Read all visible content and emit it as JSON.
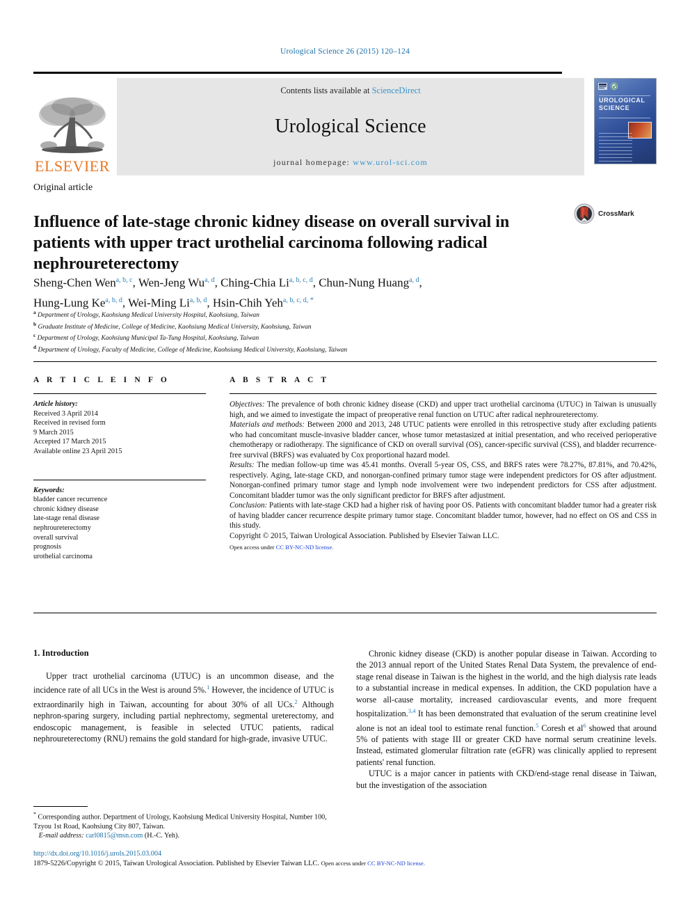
{
  "running_head": "Urological Science 26 (2015) 120–124",
  "masthead": {
    "contents_prefix": "Contents lists available at ",
    "sciencedirect": "ScienceDirect",
    "journal_name": "Urological Science",
    "homepage_prefix": "journal homepage: ",
    "homepage_url": "www.urol-sci.com",
    "publisher_logo_text": "ELSEVIER",
    "cover_title_line1": "UROLOGICAL",
    "cover_title_line2": "SCIENCE"
  },
  "article": {
    "type": "Original article",
    "title": "Influence of late-stage chronic kidney disease on overall survival in patients with upper tract urothelial carcinoma following radical nephroureterectomy",
    "crossmark_label": "CrossMark"
  },
  "authors": {
    "line1": "Sheng-Chen Wen a, b, c, Wen-Jeng Wu a, d, Ching-Chia Li a, b, c, d, Chun-Nung Huang a, d,",
    "line2": "Hung-Lung Ke a, b, d, Wei-Ming Li a, b, d, Hsin-Chih Yeh a, b, c, d, *",
    "list": [
      {
        "name": "Sheng-Chen Wen",
        "marks": "a, b, c"
      },
      {
        "name": "Wen-Jeng Wu",
        "marks": "a, d"
      },
      {
        "name": "Ching-Chia Li",
        "marks": "a, b, c, d"
      },
      {
        "name": "Chun-Nung Huang",
        "marks": "a, d"
      },
      {
        "name": "Hung-Lung Ke",
        "marks": "a, b, d"
      },
      {
        "name": "Wei-Ming Li",
        "marks": "a, b, d"
      },
      {
        "name": "Hsin-Chih Yeh",
        "marks": "a, b, c, d, *"
      }
    ]
  },
  "affiliations": [
    {
      "label": "a",
      "text": "Department of Urology, Kaohsiung Medical University Hospital, Kaohsiung, Taiwan"
    },
    {
      "label": "b",
      "text": "Graduate Institute of Medicine, College of Medicine, Kaohsiung Medical University, Kaohsiung, Taiwan"
    },
    {
      "label": "c",
      "text": "Department of Urology, Kaohsiung Municipal Ta-Tung Hospital, Kaohsiung, Taiwan"
    },
    {
      "label": "d",
      "text": "Department of Urology, Faculty of Medicine, College of Medicine, Kaohsiung Medical University, Kaohsiung, Taiwan"
    }
  ],
  "article_info": {
    "heading": "A R T I C L E  I N F O",
    "history_label": "Article history:",
    "history": [
      "Received 3 April 2014",
      "Received in revised form",
      "9 March 2015",
      "Accepted 17 March 2015",
      "Available online 23 April 2015"
    ],
    "keywords_label": "Keywords:",
    "keywords": [
      "bladder cancer recurrence",
      "chronic kidney disease",
      "late-stage renal disease",
      "nephroureterectomy",
      "overall survival",
      "prognosis",
      "urothelial carcinoma"
    ]
  },
  "abstract": {
    "heading": "A B S T R A C T",
    "objectives_label": "Objectives:",
    "objectives": " The prevalence of both chronic kidney disease (CKD) and upper tract urothelial carcinoma (UTUC) in Taiwan is unusually high, and we aimed to investigate the impact of preoperative renal function on UTUC after radical nephroureterectomy.",
    "methods_label": "Materials and methods:",
    "methods": " Between 2000 and 2013, 248 UTUC patients were enrolled in this retrospective study after excluding patients who had concomitant muscle-invasive bladder cancer, whose tumor metastasized at initial presentation, and who received perioperative chemotherapy or radiotherapy. The significance of CKD on overall survival (OS), cancer-specific survival (CSS), and bladder recurrence-free survival (BRFS) was evaluated by Cox proportional hazard model.",
    "results_label": "Results:",
    "results": " The median follow-up time was 45.41 months. Overall 5-year OS, CSS, and BRFS rates were 78.27%, 87.81%, and 70.42%, respectively. Aging, late-stage CKD, and nonorgan-confined primary tumor stage were independent predictors for OS after adjustment. Nonorgan-confined primary tumor stage and lymph node involvement were two independent predictors for CSS after adjustment. Concomitant bladder tumor was the only significant predictor for BRFS after adjustment.",
    "conclusion_label": "Conclusion:",
    "conclusion": " Patients with late-stage CKD had a higher risk of having poor OS. Patients with concomitant bladder tumor had a greater risk of having bladder cancer recurrence despite primary tumor stage. Concomitant bladder tumor, however, had no effect on OS and CSS in this study.",
    "copyright": "Copyright © 2015, Taiwan Urological Association. Published by Elsevier Taiwan LLC.",
    "open_access_prefix": "Open access under ",
    "open_access_link": "CC BY-NC-ND license."
  },
  "body": {
    "section_number_title": "1.  Introduction",
    "left_paragraph_1": "Upper tract urothelial carcinoma (UTUC) is an uncommon disease, and the incidence rate of all UCs in the West is around 5%.",
    "left_ref_1": "1",
    "left_paragraph_1b": " However, the incidence of UTUC is extraordinarily high in Taiwan, accounting for about 30% of all UCs.",
    "left_ref_2": "2",
    "left_paragraph_1c": " Although nephron-sparing surgery, including partial nephrectomy, segmental ureterectomy, and endoscopic management, is feasible in selected UTUC patients, radical nephroureterectomy (RNU) remains the gold standard for high-grade, invasive UTUC.",
    "right_paragraph_1a": "Chronic kidney disease (CKD) is another popular disease in Taiwan. According to the 2013 annual report of the United States Renal Data System, the prevalence of end-stage renal disease in Taiwan is the highest in the world, and the high dialysis rate leads to a substantial increase in medical expenses. In addition, the CKD population have a worse all-cause mortality, increased cardiovascular events, and more frequent hospitalization.",
    "right_ref_34": "3,4",
    "right_paragraph_1b": " It has been demonstrated that evaluation of the serum creatinine level alone is not an ideal tool to estimate renal function.",
    "right_ref_5": "5",
    "right_paragraph_1c": " Coresh et al",
    "right_ref_6": "6",
    "right_paragraph_1d": " showed that around 5% of patients with stage III or greater CKD have normal serum creatinine levels. Instead, estimated glomerular filtration rate (eGFR) was clinically applied to represent patients' renal function.",
    "right_paragraph_2": "UTUC is a major cancer in patients with CKD/end-stage renal disease in Taiwan, but the investigation of the association"
  },
  "footer": {
    "corresponding_star": "*",
    "corresponding": " Corresponding author. Department of Urology, Kaohsiung Medical University Hospital, Number 100, Tzyou 1st Road, Kaohsiung City 807, Taiwan.",
    "email_label": "E-mail address:",
    "email": "carl0815@msn.com",
    "email_suffix": " (H.-C. Yeh).",
    "doi": "http://dx.doi.org/10.1016/j.urols.2015.03.004",
    "copyright_line": "1879-5226/Copyright © 2015, Taiwan Urological Association. Published by Elsevier Taiwan LLC. ",
    "copyright_open_prefix": "Open access under ",
    "copyright_open_link": "CC BY-NC-ND license."
  },
  "colors": {
    "link_blue": "#1a6fa8",
    "sup_blue": "#2a7fb8",
    "cc_blue": "#1a3fd0",
    "elsevier_orange": "#E87722"
  }
}
